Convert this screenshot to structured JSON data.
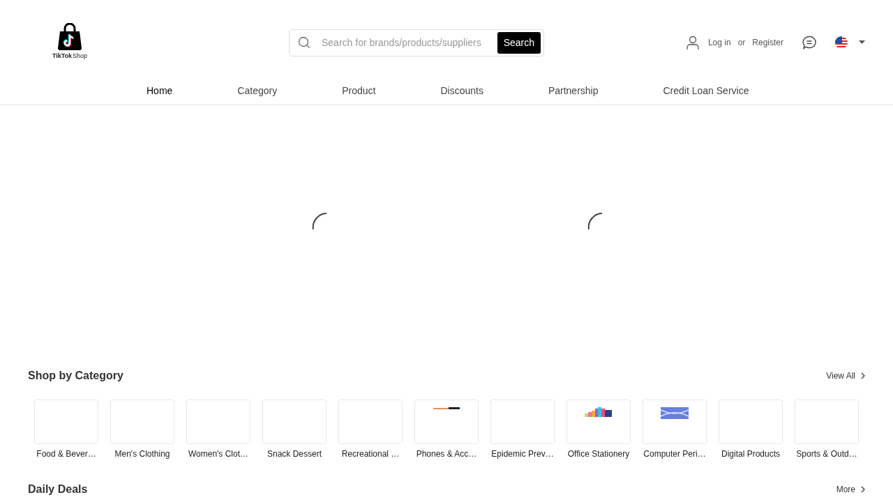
{
  "logo": {
    "brand": "TikTok",
    "suffix": "Shop"
  },
  "search": {
    "placeholder": "Search for brands/products/suppliers",
    "button": "Search"
  },
  "account": {
    "login": "Log in",
    "separator": "or",
    "register": "Register"
  },
  "nav": [
    {
      "label": "Home",
      "selected": true
    },
    {
      "label": "Category",
      "selected": false
    },
    {
      "label": "Product",
      "selected": false
    },
    {
      "label": "Discounts",
      "selected": false
    },
    {
      "label": "Partnership",
      "selected": false
    },
    {
      "label": "Credit Loan Service",
      "selected": false
    }
  ],
  "shop_by_category": {
    "title": "Shop by Category",
    "link": "View All",
    "items": [
      {
        "label": "Food & Bever…",
        "kind": "blank"
      },
      {
        "label": "Men's Clothing",
        "kind": "blank"
      },
      {
        "label": "Women's Clot…",
        "kind": "blank"
      },
      {
        "label": "Snack Dessert",
        "kind": "blank"
      },
      {
        "label": "Recreational …",
        "kind": "blank"
      },
      {
        "label": "Phones & Acc…",
        "kind": "cable"
      },
      {
        "label": "Epidemic Prev…",
        "kind": "blank"
      },
      {
        "label": "Office Stationery",
        "kind": "books"
      },
      {
        "label": "Computer Peri…",
        "kind": "monitor"
      },
      {
        "label": "Digital Products",
        "kind": "blank"
      },
      {
        "label": "Sports & Outd…",
        "kind": "blank"
      }
    ]
  },
  "daily_deals": {
    "title": "Daily Deals",
    "link": "More"
  }
}
